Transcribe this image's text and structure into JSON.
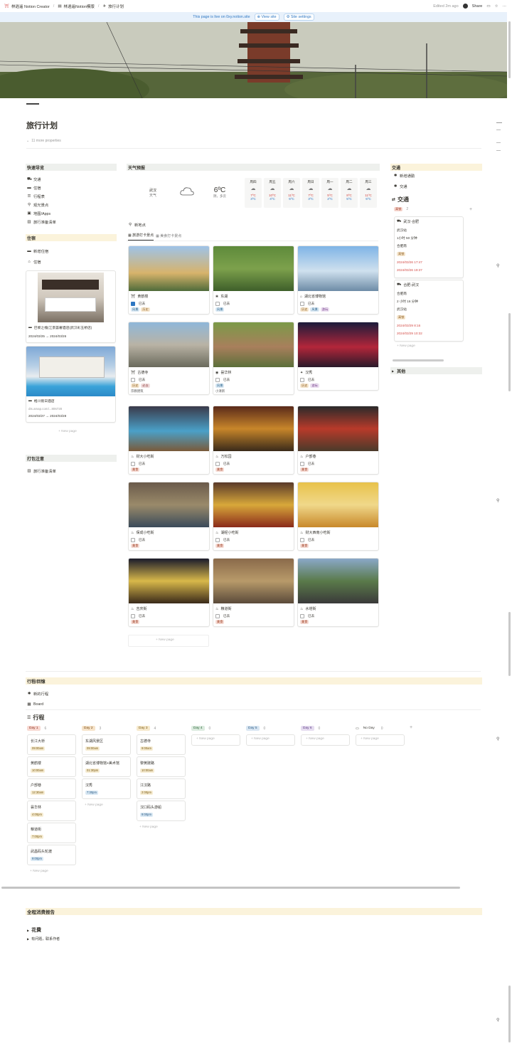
{
  "topbar": {
    "crumbs": [
      "林逍遥 Notion Creator",
      "林逍遥Notion模版",
      "旅行计划"
    ],
    "edited": "Edited 2m ago",
    "share": "Share"
  },
  "banner": {
    "text": "This page is live on 0xy.notion.site",
    "view_site": "View site",
    "site_settings": "Site settings"
  },
  "page": {
    "title": "旅行计划",
    "more_props": "11 more properties"
  },
  "quick_nav": {
    "header": "快速导览",
    "items": [
      "交通",
      "住宿",
      "行程表",
      "观光景点",
      "地图/Apps",
      "旅行准备清单"
    ]
  },
  "lodging": {
    "header": "住宿",
    "new_label": "新增住宿",
    "db_label": "住宿",
    "hotels": [
      {
        "name": "巴黎之槐(江景荟奢酒店(武汉彩玉桥店)",
        "dates": "2024/03/25 → 2024/03/26"
      },
      {
        "name": "格川假日酒店",
        "url": "dts.amap.com/...806728",
        "dates": "2024/03/27 → 2024/03/28"
      }
    ],
    "new_page": "+ New page"
  },
  "packing": {
    "header": "打包注意",
    "item": "旅行准备清单"
  },
  "weather": {
    "header": "天气预报",
    "city": "武汉",
    "sub": "天气",
    "temp": "6ºC",
    "cond": "阴，多云",
    "days": [
      {
        "d": "周四",
        "hi": "7ºC",
        "lo": "3ºC"
      },
      {
        "d": "周五",
        "hi": "10ºC",
        "lo": "4ºC"
      },
      {
        "d": "周六",
        "hi": "11ºC",
        "lo": "5ºC"
      },
      {
        "d": "周日",
        "hi": "7ºC",
        "lo": "3ºC"
      },
      {
        "d": "周一",
        "hi": "5ºC",
        "lo": "2ºC"
      },
      {
        "d": "周二",
        "hi": "8ºC",
        "lo": "5ºC"
      },
      {
        "d": "周三",
        "hi": "11ºC",
        "lo": "5ºC"
      }
    ]
  },
  "spots": {
    "new_label": "新地点",
    "tab1": "旅游打卡景点",
    "tab2": "美食打卡景点",
    "checked_label": "已去",
    "new_page": "+ New page",
    "cards": [
      {
        "name": "黄鹤楼",
        "tags": [
          "风景",
          "历史"
        ],
        "checked": true
      },
      {
        "name": "东湖",
        "tags": [
          "风景"
        ],
        "checked": false
      },
      {
        "name": "湖北省博物馆",
        "tags": [
          "历史",
          "风景",
          "游玩"
        ],
        "checked": false
      },
      {
        "name": "古德寺",
        "tags": [
          "历史",
          "必去"
        ],
        "note": "宗教建筑",
        "checked": false
      },
      {
        "name": "昙华林",
        "tags": [
          "风景"
        ],
        "note": "小清新",
        "checked": false
      },
      {
        "name": "汉秀",
        "tags": [
          "历史",
          "游玩"
        ],
        "checked": false
      },
      {
        "name": "财大小吃街",
        "tags": [
          "美食"
        ],
        "checked": false
      },
      {
        "name": "万松园",
        "tags": [
          "美食"
        ],
        "checked": false
      },
      {
        "name": "户部巷",
        "tags": [
          "美食"
        ],
        "checked": false
      },
      {
        "name": "保成小吃街",
        "tags": [
          "美食"
        ],
        "checked": false
      },
      {
        "name": "湖经小吃街",
        "tags": [
          "美食"
        ],
        "checked": false
      },
      {
        "name": "财大西南小吃街",
        "tags": [
          "美食"
        ],
        "checked": false
      },
      {
        "name": "吉庆街",
        "tags": [
          "美食"
        ],
        "checked": false
      },
      {
        "name": "粮道街",
        "tags": [
          "美食"
        ],
        "checked": false
      },
      {
        "name": "水塔街",
        "tags": [
          "美食"
        ],
        "checked": false
      }
    ]
  },
  "transport": {
    "header": "交通",
    "new_label": "新增通勤",
    "db_label": "交通",
    "title": "交通",
    "group": "高铁",
    "group_count": "2",
    "items": [
      {
        "name": "武汉-合肥",
        "from": "武汉站",
        "dur": "1小时 50 分钟",
        "to": "合肥南",
        "tag": "高铁",
        "t1": "2024/03/26 17:47",
        "t2": "2024/03/26 19:37"
      },
      {
        "name": "合肥-武汉",
        "from": "合肥南",
        "dur": "2 小时 16 分钟",
        "to": "武汉站",
        "tag": "高铁",
        "t1": "2024/03/29 8:16",
        "t2": "2024/03/29 10:32"
      }
    ],
    "new_page": "+ New page",
    "other": "其他"
  },
  "itinerary": {
    "header": "行程/回憶",
    "new_label": "新的行程",
    "view": "Board",
    "title": "行程",
    "new_page": "+ New page",
    "columns": [
      {
        "name": "Day 1",
        "count": "6",
        "color": "#f8d9d2",
        "text": "#8a2f1d",
        "cards": [
          {
            "n": "长江大桥",
            "t": "09:00am",
            "c": "y"
          },
          {
            "n": "黄鹤楼",
            "t": "10:00am",
            "c": "y"
          },
          {
            "n": "户部巷",
            "t": "12:30am",
            "c": "y"
          },
          {
            "n": "昙华林",
            "t": "4:00pm",
            "c": "y"
          },
          {
            "n": "粮道街",
            "t": "7:00pm",
            "c": "y"
          },
          {
            "n": "武昌码头轮渡",
            "t": "9:00pm",
            "c": "b"
          }
        ]
      },
      {
        "name": "Day 2",
        "count": "3",
        "color": "#f6e3c9",
        "text": "#7a4a12",
        "cards": [
          {
            "n": "东湖风景区",
            "t": "09:00am",
            "c": "y"
          },
          {
            "n": "湖北省博物馆+美术馆",
            "t": "01:30pm",
            "c": "y"
          },
          {
            "n": "汉秀",
            "t": "7:30pm",
            "c": "b"
          }
        ]
      },
      {
        "name": "Day 3",
        "count": "4",
        "color": "#f6e9cc",
        "text": "#7b5a12",
        "cards": [
          {
            "n": "古德寺",
            "t": "9:00am",
            "c": "y"
          },
          {
            "n": "黎黄陂路",
            "t": "10:00am",
            "c": "y"
          },
          {
            "n": "江汉路",
            "t": "2:00pm",
            "c": "y"
          },
          {
            "n": "汉口码头游船",
            "t": "9:00pm",
            "c": "b"
          }
        ]
      },
      {
        "name": "Day 4",
        "count": "0",
        "color": "#dcebdf",
        "text": "#2e6a3c",
        "cards": []
      },
      {
        "name": "Day 5",
        "count": "0",
        "color": "#d9e6f2",
        "text": "#2a5b86",
        "cards": []
      },
      {
        "name": "Day 6",
        "count": "0",
        "color": "#e6ddf0",
        "text": "#5c3a85",
        "cards": []
      },
      {
        "name": "No Day",
        "count": "0",
        "color": "#ffffff",
        "text": "#37352f",
        "cards": []
      }
    ]
  },
  "expense": {
    "header": "全程消费报告",
    "toggle": "花費",
    "sub": "有问题，联系作者"
  }
}
